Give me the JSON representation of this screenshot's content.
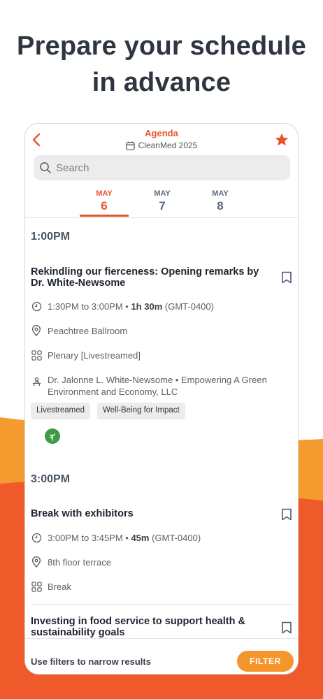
{
  "headline": {
    "line1": "Prepare your schedule",
    "line2": "in advance"
  },
  "colors": {
    "accent": "#e8552b",
    "orange": "#f5962c",
    "wave_orange": "#f59a2e",
    "wave_red": "#ef5a2a",
    "tab_inactive": "#5b6a7d"
  },
  "app": {
    "title": "Agenda",
    "subtitle": "CleanMed 2025",
    "search": {
      "placeholder": "Search"
    },
    "tabs": [
      {
        "month": "MAY",
        "day": "6",
        "active": true
      },
      {
        "month": "MAY",
        "day": "7",
        "active": false
      },
      {
        "month": "MAY",
        "day": "8",
        "active": false
      }
    ],
    "sections": [
      {
        "time": "1:00PM",
        "sessions": [
          {
            "title": "Rekindling our fierceness: Opening remarks by Dr. White-Newsome",
            "time_range": "1:30PM to 3:00PM",
            "duration": "1h 30m",
            "tz": "(GMT-0400)",
            "location": "Peachtree Ballroom",
            "type": "Plenary [Livestreamed]",
            "speaker": "Dr. Jalonne L. White-Newsome • Empowering A Green Environment and Economy, LLC",
            "tags": [
              "Livestreamed",
              "Well-Being for Impact"
            ]
          }
        ]
      },
      {
        "time": "3:00PM",
        "sessions": [
          {
            "title": "Break with exhibitors",
            "time_range": "3:00PM to 3:45PM",
            "duration": "45m",
            "tz": "(GMT-0400)",
            "location": "8th floor terrace",
            "type": "Break"
          },
          {
            "title": "Investing in food service to support health & sustainability goals"
          }
        ]
      }
    ],
    "footer": {
      "hint": "Use filters to narrow results",
      "filter_label": "FILTER"
    },
    "icons": [
      "back-arrow-icon",
      "star-icon",
      "calendar-icon",
      "search-icon",
      "bookmark-icon",
      "clock-icon",
      "location-pin-icon",
      "grid-icon",
      "speaker-icon",
      "sponsor-logo-icon"
    ]
  }
}
